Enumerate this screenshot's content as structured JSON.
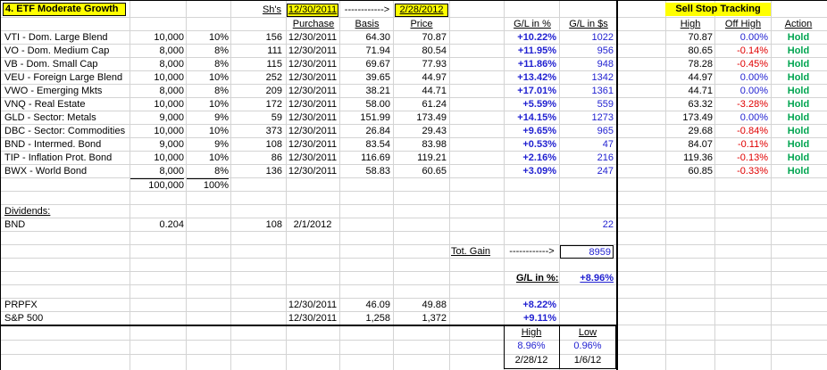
{
  "title": "4. ETF Moderate Growth",
  "header": {
    "shares": "Sh's",
    "purchase_date": "12/30/2011",
    "arrow": "------------>",
    "price_date": "2/28/2012",
    "purchase": "Purchase",
    "basis": "Basis",
    "price": "Price",
    "gl_pct": "G/L in %",
    "gl_dollars": "G/L in $s"
  },
  "sell_stop": {
    "title": "Sell Stop Tracking",
    "high": "High",
    "off_high": "Off High",
    "action": "Action"
  },
  "holdings": [
    {
      "name": "VTI - Dom. Large Blend",
      "alloc": "10,000",
      "pct": "10%",
      "shares": "156",
      "date": "12/30/2011",
      "basis": "64.30",
      "price": "70.87",
      "glp": "+10.22%",
      "gld": "1022",
      "high": "70.87",
      "off": "0.00%",
      "action": "Hold"
    },
    {
      "name": "VO - Dom. Medium Cap",
      "alloc": "8,000",
      "pct": "8%",
      "shares": "111",
      "date": "12/30/2011",
      "basis": "71.94",
      "price": "80.54",
      "glp": "+11.95%",
      "gld": "956",
      "high": "80.65",
      "off": "-0.14%",
      "action": "Hold"
    },
    {
      "name": "VB - Dom. Small Cap",
      "alloc": "8,000",
      "pct": "8%",
      "shares": "115",
      "date": "12/30/2011",
      "basis": "69.67",
      "price": "77.93",
      "glp": "+11.86%",
      "gld": "948",
      "high": "78.28",
      "off": "-0.45%",
      "action": "Hold"
    },
    {
      "name": "VEU - Foreign Large Blend",
      "alloc": "10,000",
      "pct": "10%",
      "shares": "252",
      "date": "12/30/2011",
      "basis": "39.65",
      "price": "44.97",
      "glp": "+13.42%",
      "gld": "1342",
      "high": "44.97",
      "off": "0.00%",
      "action": "Hold"
    },
    {
      "name": "VWO - Emerging Mkts",
      "alloc": "8,000",
      "pct": "8%",
      "shares": "209",
      "date": "12/30/2011",
      "basis": "38.21",
      "price": "44.71",
      "glp": "+17.01%",
      "gld": "1361",
      "high": "44.71",
      "off": "0.00%",
      "action": "Hold"
    },
    {
      "name": "VNQ - Real Estate",
      "alloc": "10,000",
      "pct": "10%",
      "shares": "172",
      "date": "12/30/2011",
      "basis": "58.00",
      "price": "61.24",
      "glp": "+5.59%",
      "gld": "559",
      "high": "63.32",
      "off": "-3.28%",
      "action": "Hold"
    },
    {
      "name": "GLD - Sector: Metals",
      "alloc": "9,000",
      "pct": "9%",
      "shares": "59",
      "date": "12/30/2011",
      "basis": "151.99",
      "price": "173.49",
      "glp": "+14.15%",
      "gld": "1273",
      "high": "173.49",
      "off": "0.00%",
      "action": "Hold"
    },
    {
      "name": "DBC - Sector: Commodities",
      "alloc": "10,000",
      "pct": "10%",
      "shares": "373",
      "date": "12/30/2011",
      "basis": "26.84",
      "price": "29.43",
      "glp": "+9.65%",
      "gld": "965",
      "high": "29.68",
      "off": "-0.84%",
      "action": "Hold"
    },
    {
      "name": "BND - Intermed. Bond",
      "alloc": "9,000",
      "pct": "9%",
      "shares": "108",
      "date": "12/30/2011",
      "basis": "83.54",
      "price": "83.98",
      "glp": "+0.53%",
      "gld": "47",
      "high": "84.07",
      "off": "-0.11%",
      "action": "Hold"
    },
    {
      "name": "TIP - Inflation Prot. Bond",
      "alloc": "10,000",
      "pct": "10%",
      "shares": "86",
      "date": "12/30/2011",
      "basis": "116.69",
      "price": "119.21",
      "glp": "+2.16%",
      "gld": "216",
      "high": "119.36",
      "off": "-0.13%",
      "action": "Hold"
    },
    {
      "name": "BWX - World Bond",
      "alloc": "8,000",
      "pct": "8%",
      "shares": "136",
      "date": "12/30/2011",
      "basis": "58.83",
      "price": "60.65",
      "glp": "+3.09%",
      "gld": "247",
      "high": "60.85",
      "off": "-0.33%",
      "action": "Hold"
    }
  ],
  "totals": {
    "alloc": "100,000",
    "pct": "100%"
  },
  "dividends": {
    "label": "Dividends:",
    "name": "BND",
    "amount": "0.204",
    "shares": "108",
    "date": "2/1/2012",
    "value": "22"
  },
  "summary": {
    "tot_gain_label": "Tot. Gain",
    "tot_gain_arrow": "------------>",
    "tot_gain_value": "8959",
    "gl_label": "G/L in %:",
    "gl_value": "+8.96%"
  },
  "benchmarks": [
    {
      "name": "PRPFX",
      "date": "12/30/2011",
      "basis": "46.09",
      "price": "49.88",
      "glp": "+8.22%"
    },
    {
      "name": "S&P 500",
      "date": "12/30/2011",
      "basis": "1,258",
      "price": "1,372",
      "glp": "+9.11%"
    }
  ],
  "highlow": {
    "high_label": "High",
    "low_label": "Low",
    "high_value": "8.96%",
    "low_value": "0.96%",
    "high_date": "2/28/12",
    "low_date": "1/6/12"
  },
  "colors": {
    "highlight": "#ffff00",
    "positive": "#1f1fd0",
    "negative": "#e00000",
    "action": "#00a550"
  }
}
